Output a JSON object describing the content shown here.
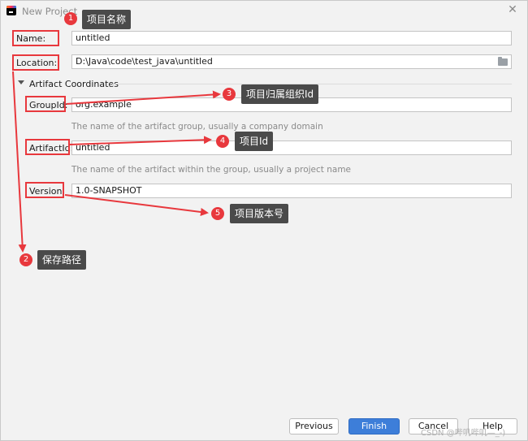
{
  "window": {
    "title": "New Project",
    "close_glyph": "✕"
  },
  "fields": {
    "name_label": "Name:",
    "name_value": "untitled",
    "location_label": "Location:",
    "location_value": "D:\\Java\\code\\test_java\\untitled",
    "section_title": "Artifact Coordinates",
    "groupid_label": "GroupId:",
    "groupid_value": "org.example",
    "groupid_hint": "The name of the artifact group, usually a company domain",
    "artifactid_label": "ArtifactId:",
    "artifactid_value": "untitled",
    "artifactid_hint": "The name of the artifact within the group, usually a project name",
    "version_label": "Version:",
    "version_value": "1.0-SNAPSHOT"
  },
  "annotations": [
    {
      "num": "1",
      "text": "项目名称"
    },
    {
      "num": "2",
      "text": "保存路径"
    },
    {
      "num": "3",
      "text": "项目归属组织Id"
    },
    {
      "num": "4",
      "text": "项目Id"
    },
    {
      "num": "5",
      "text": "项目版本号"
    }
  ],
  "buttons": {
    "previous": "Previous",
    "finish": "Finish",
    "cancel": "Cancel",
    "help": "Help"
  },
  "watermark": "CSDN @哔叽哔叽—_-)",
  "colors": {
    "accent": "#3d7ed9",
    "annotation_red": "#e8383d",
    "tag_bg": "#4a4a4a"
  }
}
